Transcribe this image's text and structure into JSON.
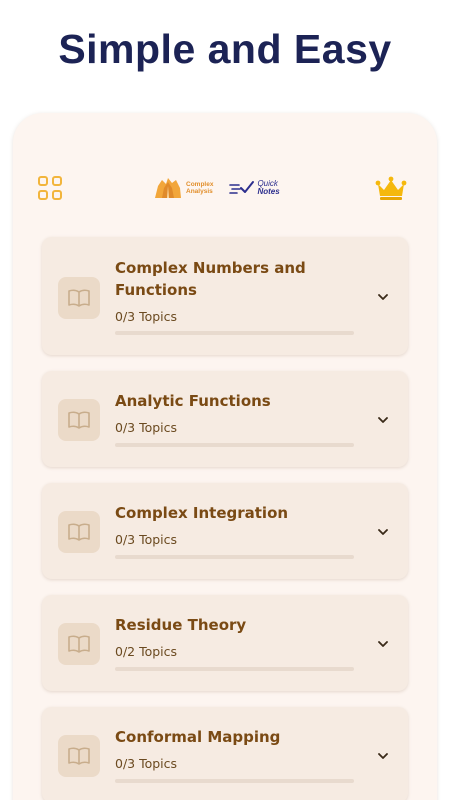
{
  "headline": "Simple and Easy",
  "header": {
    "menu_icon": "grid-icon",
    "logo_complex": {
      "line1": "Complex",
      "line2": "Analysis",
      "color": "#e28f2c"
    },
    "logo_quick": {
      "line1": "Quick",
      "line2": "Notes",
      "color": "#2d2f8e"
    },
    "premium_icon": "crown-icon",
    "accent": "#f2b53c"
  },
  "chapters": [
    {
      "title": "Complex Numbers and Functions",
      "topics": "0/3 Topics",
      "progress": 0
    },
    {
      "title": "Analytic Functions",
      "topics": "0/3 Topics",
      "progress": 0
    },
    {
      "title": "Complex Integration",
      "topics": "0/3 Topics",
      "progress": 0
    },
    {
      "title": "Residue Theory",
      "topics": "0/2 Topics",
      "progress": 0
    },
    {
      "title": "Conformal Mapping",
      "topics": "0/3 Topics",
      "progress": 0
    }
  ],
  "colors": {
    "title": "#1c2355",
    "card_bg": "#f6ebe2",
    "chapter_text": "#7a4a14",
    "phone_bg": "#fdf5f0"
  }
}
